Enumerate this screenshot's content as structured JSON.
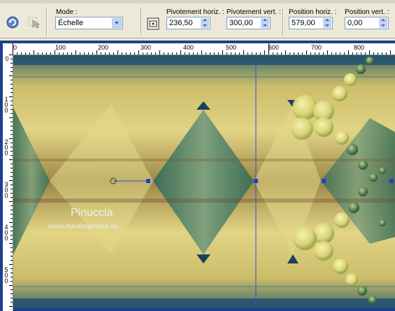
{
  "toolbar": {
    "mode_label": "Mode :",
    "mode_value": "Échelle",
    "pivot_h_label": "Pivotement horiz. :",
    "pivot_h_value": "236,50",
    "pivot_v_label": "Pivotement vert. :",
    "pivot_v_value": "300,00",
    "pos_h_label": "Position horiz. :",
    "pos_h_value": "579,00",
    "pos_v_label": "Position vert. :",
    "pos_v_value": "0,00"
  },
  "ruler": {
    "h_labels": [
      "0",
      "100",
      "200",
      "300",
      "400",
      "500",
      "600",
      "700",
      "800"
    ],
    "v_labels": [
      "0",
      "100",
      "200",
      "300",
      "400",
      "500"
    ]
  },
  "watermark": {
    "name": "Pinuccia",
    "site": "www.maidiregrafica.eu"
  },
  "colors": {
    "frame": "#1f3f8f",
    "handle": "#1f3fd0",
    "guide": "#2f4fd8"
  }
}
